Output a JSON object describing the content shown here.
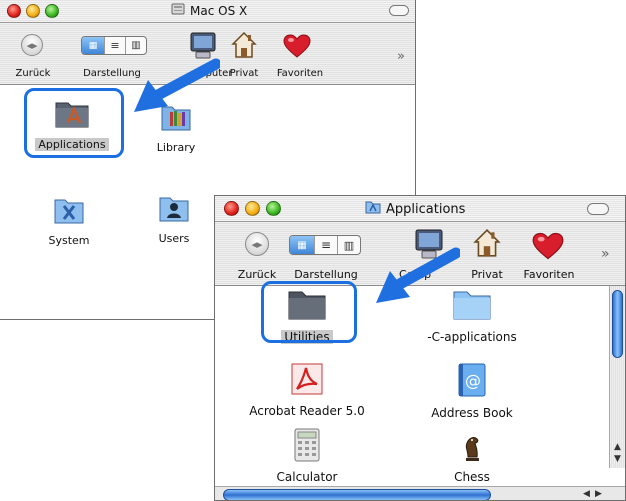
{
  "window1": {
    "title": "Mac OS X",
    "toolbar": {
      "back_label": "Zurück",
      "view_label": "Darstellung",
      "computer_label": "puter",
      "home_label": "Privat",
      "favorites_label": "Favoriten",
      "more": "»"
    },
    "items": [
      "Applications",
      "Library",
      "System",
      "Users"
    ],
    "selected_item": "Applications"
  },
  "window2": {
    "title": "Applications",
    "toolbar": {
      "back_label": "Zurück",
      "view_label": "Darstellung",
      "computer_label": "Comp",
      "home_label": "Privat",
      "favorites_label": "Favoriten",
      "more": "»"
    },
    "items": [
      "Utilities",
      "-C-applications",
      "Acrobat Reader 5.0",
      "Address Book",
      "Calculator",
      "Chess"
    ],
    "selected_item": "Utilities"
  },
  "colors": {
    "highlight_ring": "#1c6fe0",
    "arrow": "#1f6fe0",
    "selection": "#c9c9c9"
  }
}
